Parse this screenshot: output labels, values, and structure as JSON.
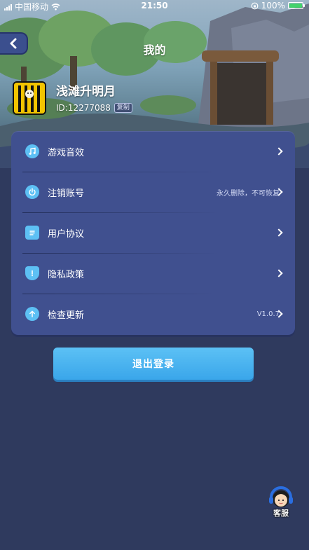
{
  "status_bar": {
    "carrier": "中国移动",
    "time": "21:50",
    "battery": "100%"
  },
  "header": {
    "title": "我的"
  },
  "profile": {
    "name": "浅滩升明月",
    "id_text": "ID:12277088",
    "copy_label": "复制"
  },
  "settings": {
    "items": [
      {
        "label": "游戏音效",
        "hint": "",
        "icon": "music-note-icon"
      },
      {
        "label": "注销账号",
        "hint": "永久删除，不可恢复",
        "icon": "power-icon"
      },
      {
        "label": "用户协议",
        "hint": "",
        "icon": "document-icon"
      },
      {
        "label": "隐私政策",
        "hint": "",
        "icon": "shield-icon"
      },
      {
        "label": "检查更新",
        "hint": "V1.0.7",
        "icon": "arrow-up-icon"
      }
    ]
  },
  "logout": {
    "label": "退出登录"
  },
  "customer_service": {
    "label": "客服"
  },
  "colors": {
    "background": "#2f3a5e",
    "card": "#40508f",
    "accent": "#5dc0f4",
    "logout_button": "#4ab3f0"
  }
}
